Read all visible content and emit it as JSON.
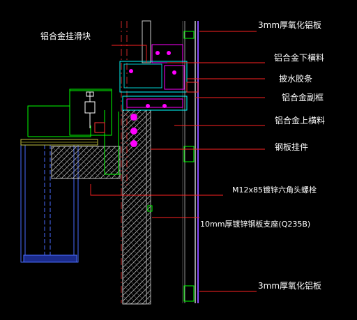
{
  "labels": {
    "top_panel": "3mm厚氧化铝板",
    "slider_block": "铝合金挂滑块",
    "lower_transom": "铝合金下横料",
    "water_strip": "披水胶条",
    "sub_frame": "铝合金副框",
    "upper_transom": "铝合金上横料",
    "steel_hanger": "钢板挂件",
    "bolt": "M12x85镀锌六角头螺栓",
    "bracket_plate": "10mm厚镀锌钢板支座(Q235B)",
    "bottom_panel": "3mm厚氧化铝板"
  },
  "colors": {
    "background": "#000000",
    "leader": "#ff2222",
    "profile": "#00ffff",
    "steel": "#00ff00",
    "bolt": "#ff00ff",
    "panel": "#ffffff",
    "gasket": "#ff3333"
  }
}
